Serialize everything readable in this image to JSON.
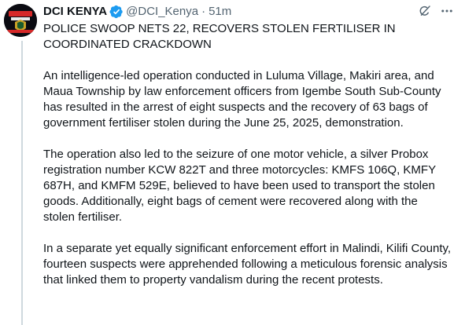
{
  "tweet": {
    "author_name": "DCI KENYA",
    "handle": "@DCI_Kenya",
    "separator": "·",
    "time": "51m",
    "avatar_text": "#FICHUAKWADCI 0800 722 203",
    "paragraphs": [
      "POLICE SWOOP NETS 22, RECOVERS STOLEN FERTILISER IN COORDINATED CRACKDOWN",
      "An intelligence-led operation conducted in Luluma Village, Makiri area, and Maua Township by law enforcement officers from Igembe South Sub-County has resulted in the arrest of eight suspects and the recovery of 63 bags of government fertiliser stolen during the June 25, 2025, demonstration.",
      "The operation also led to the seizure of one motor vehicle, a silver Probox registration number KCW 822T and three motorcycles: KMFS 106Q, KMFY 687H, and KMFM 529E, believed to have been used to transport the stolen goods. Additionally, eight bags of cement were recovered along with the stolen fertiliser.",
      "In a separate yet equally significant enforcement effort in Malindi, Kilifi County, fourteen suspects were apprehended following a meticulous forensic analysis that linked them to property vandalism during the recent protests."
    ]
  },
  "icons": {
    "verified": "verified-badge-icon",
    "grok": "grok-icon",
    "more": "more-options-icon"
  },
  "colors": {
    "verified_blue": "#1d9bf0",
    "secondary_text": "#536471",
    "thread_line": "#cfd9de"
  }
}
